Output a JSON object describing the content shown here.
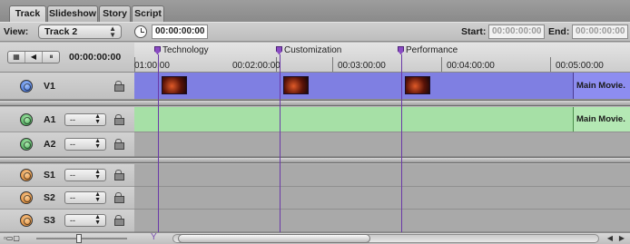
{
  "tabs": [
    "Track",
    "Slideshow",
    "Story",
    "Script"
  ],
  "active_tab": "Track",
  "toolbar": {
    "view_label": "View:",
    "view_value": "Track 2",
    "current_timecode": "00:00:00:00",
    "start_label": "Start:",
    "start_value": "00:00:00:00",
    "end_label": "End:",
    "end_value": "00:00:00:00"
  },
  "header": {
    "timecode": "00:00:00:00",
    "markers": [
      "Technology",
      "Customization",
      "Performance"
    ],
    "ruler_labels": [
      "01:00:00",
      "00:02:00:00",
      "00:03:00:00",
      "00:04:00:00",
      "00:05:00:00"
    ]
  },
  "tracks": [
    {
      "name": "V1",
      "kind": "video",
      "clip_end_label": "Main Movie."
    },
    {
      "name": "A1",
      "kind": "audio",
      "select": "--",
      "clip_end_label": "Main Movie."
    },
    {
      "name": "A2",
      "kind": "audio",
      "select": "--"
    },
    {
      "name": "S1",
      "kind": "subtitle",
      "select": "--"
    },
    {
      "name": "S2",
      "kind": "subtitle",
      "select": "--"
    },
    {
      "name": "S3",
      "kind": "subtitle",
      "select": "--"
    }
  ],
  "colors": {
    "video_lane": "#7f7fe2",
    "audio_lane": "#a6e0a6",
    "marker": "#8a4bc4"
  },
  "icons": {
    "clock": "clock-icon",
    "lock": "lock-icon",
    "marker": "chapter-marker-icon"
  }
}
